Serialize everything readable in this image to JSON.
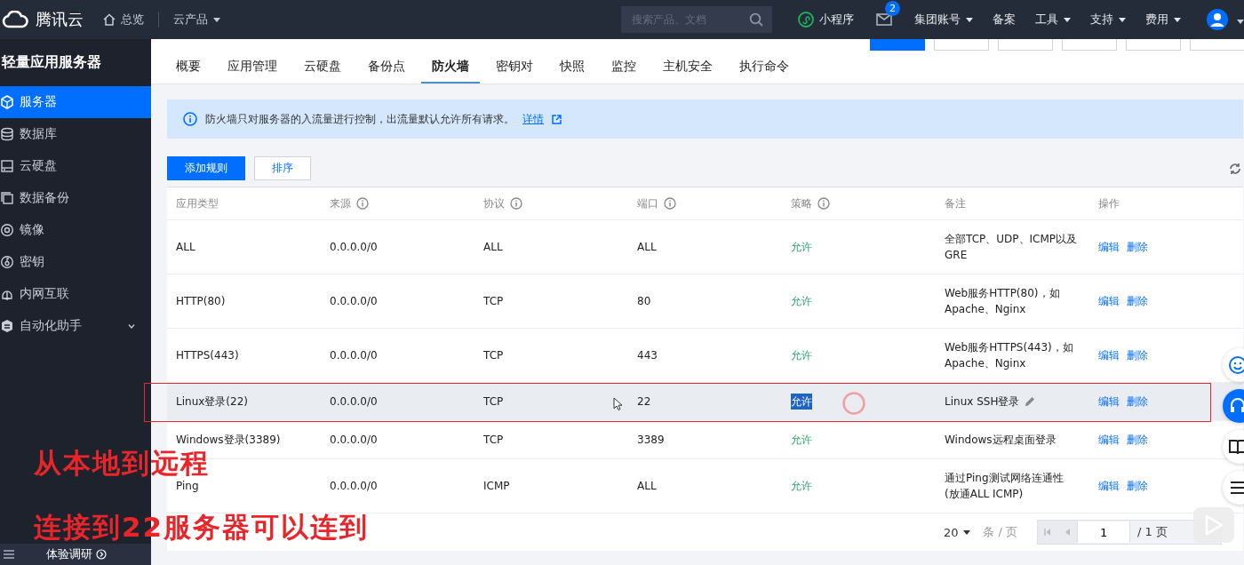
{
  "header": {
    "logo": "腾讯云",
    "nav": [
      {
        "label": "总览",
        "kind": "home"
      },
      {
        "label": "云产品",
        "kind": "dropdown"
      }
    ],
    "search": {
      "placeholder": "搜索产品、文档"
    },
    "miniapp": "小程序",
    "mail": {
      "badge": "2"
    },
    "menu": [
      {
        "label": "集团账号",
        "dropdown": true
      },
      {
        "label": "备案",
        "dropdown": false
      },
      {
        "label": "工具",
        "dropdown": true
      },
      {
        "label": "支持",
        "dropdown": true
      },
      {
        "label": "费用",
        "dropdown": true
      }
    ]
  },
  "sidebar": {
    "title": "轻量应用服务器",
    "items": [
      {
        "label": "服务器",
        "kind": "cube",
        "selected": true
      },
      {
        "label": "数据库",
        "kind": "database",
        "selected": false
      },
      {
        "label": "云硬盘",
        "kind": "disk",
        "selected": false
      },
      {
        "label": "数据备份",
        "kind": "backup",
        "selected": false
      },
      {
        "label": "镜像",
        "kind": "image",
        "selected": false
      },
      {
        "label": "密钥",
        "kind": "key",
        "selected": false
      },
      {
        "label": "内网互联",
        "kind": "network",
        "selected": false
      },
      {
        "label": "自动化助手",
        "kind": "robot",
        "selected": false,
        "expanded": false
      }
    ],
    "footer": "体验调研"
  },
  "tabs": [
    {
      "label": "概要",
      "selected": false
    },
    {
      "label": "应用管理",
      "selected": false
    },
    {
      "label": "云硬盘",
      "selected": false
    },
    {
      "label": "备份点",
      "selected": false
    },
    {
      "label": "防火墙",
      "selected": true
    },
    {
      "label": "密钥对",
      "selected": false
    },
    {
      "label": "快照",
      "selected": false
    },
    {
      "label": "监控",
      "selected": false
    },
    {
      "label": "主机安全",
      "selected": false
    },
    {
      "label": "执行命令",
      "selected": false
    }
  ],
  "notice": {
    "text": "防火墙只对服务器的入流量进行控制，出流量默认允许所有请求。",
    "link": "详情"
  },
  "actions": [
    {
      "label": "添加规则",
      "primary": true
    },
    {
      "label": "排序",
      "primary": false
    }
  ],
  "table": {
    "columns": [
      {
        "label": "应用类型",
        "info": false
      },
      {
        "label": "来源",
        "info": true
      },
      {
        "label": "协议",
        "info": true
      },
      {
        "label": "端口",
        "info": true
      },
      {
        "label": "策略",
        "info": true
      },
      {
        "label": "备注",
        "info": false
      },
      {
        "label": "操作",
        "info": false
      }
    ],
    "rows": [
      {
        "type": "ALL",
        "source": "0.0.0.0/0",
        "protocol": "ALL",
        "port": "ALL",
        "policy": "允许",
        "note": "全部TCP、UDP、ICMP以及GRE",
        "actions": [
          "编辑",
          "删除"
        ],
        "hovered": false,
        "outlined": false,
        "policy_selected": false
      },
      {
        "type": "HTTP(80)",
        "source": "0.0.0.0/0",
        "protocol": "TCP",
        "port": "80",
        "policy": "允许",
        "note": "Web服务HTTP(80)，如Apache、Nginx",
        "actions": [
          "编辑",
          "删除"
        ],
        "hovered": false,
        "outlined": false,
        "policy_selected": false
      },
      {
        "type": "HTTPS(443)",
        "source": "0.0.0.0/0",
        "protocol": "TCP",
        "port": "443",
        "policy": "允许",
        "note": "Web服务HTTPS(443)，如Apache、Nginx",
        "actions": [
          "编辑",
          "删除"
        ],
        "hovered": false,
        "outlined": false,
        "policy_selected": false
      },
      {
        "type": "Linux登录(22)",
        "source": "0.0.0.0/0",
        "protocol": "TCP",
        "port": "22",
        "policy": "允许",
        "note": "Linux SSH登录",
        "actions": [
          "编辑",
          "删除"
        ],
        "hovered": true,
        "outlined": true,
        "policy_selected": true
      },
      {
        "type": "Windows登录(3389)",
        "source": "0.0.0.0/0",
        "protocol": "TCP",
        "port": "3389",
        "policy": "允许",
        "note": "Windows远程桌面登录",
        "actions": [
          "编辑",
          "删除"
        ],
        "hovered": false,
        "outlined": false,
        "policy_selected": false
      },
      {
        "type": "Ping",
        "source": "0.0.0.0/0",
        "protocol": "ICMP",
        "port": "ALL",
        "policy": "允许",
        "note": "通过Ping测试网络连通性(放通ALL ICMP)",
        "actions": [
          "编辑",
          "删除"
        ],
        "hovered": false,
        "outlined": false,
        "policy_selected": false
      }
    ]
  },
  "pagination": {
    "page_size": "20",
    "per_page_label": "条 / 页",
    "page": "1",
    "total": "/ 1 页"
  },
  "captions": [
    "从本地到远程",
    "连接到22服务器可以连到"
  ]
}
